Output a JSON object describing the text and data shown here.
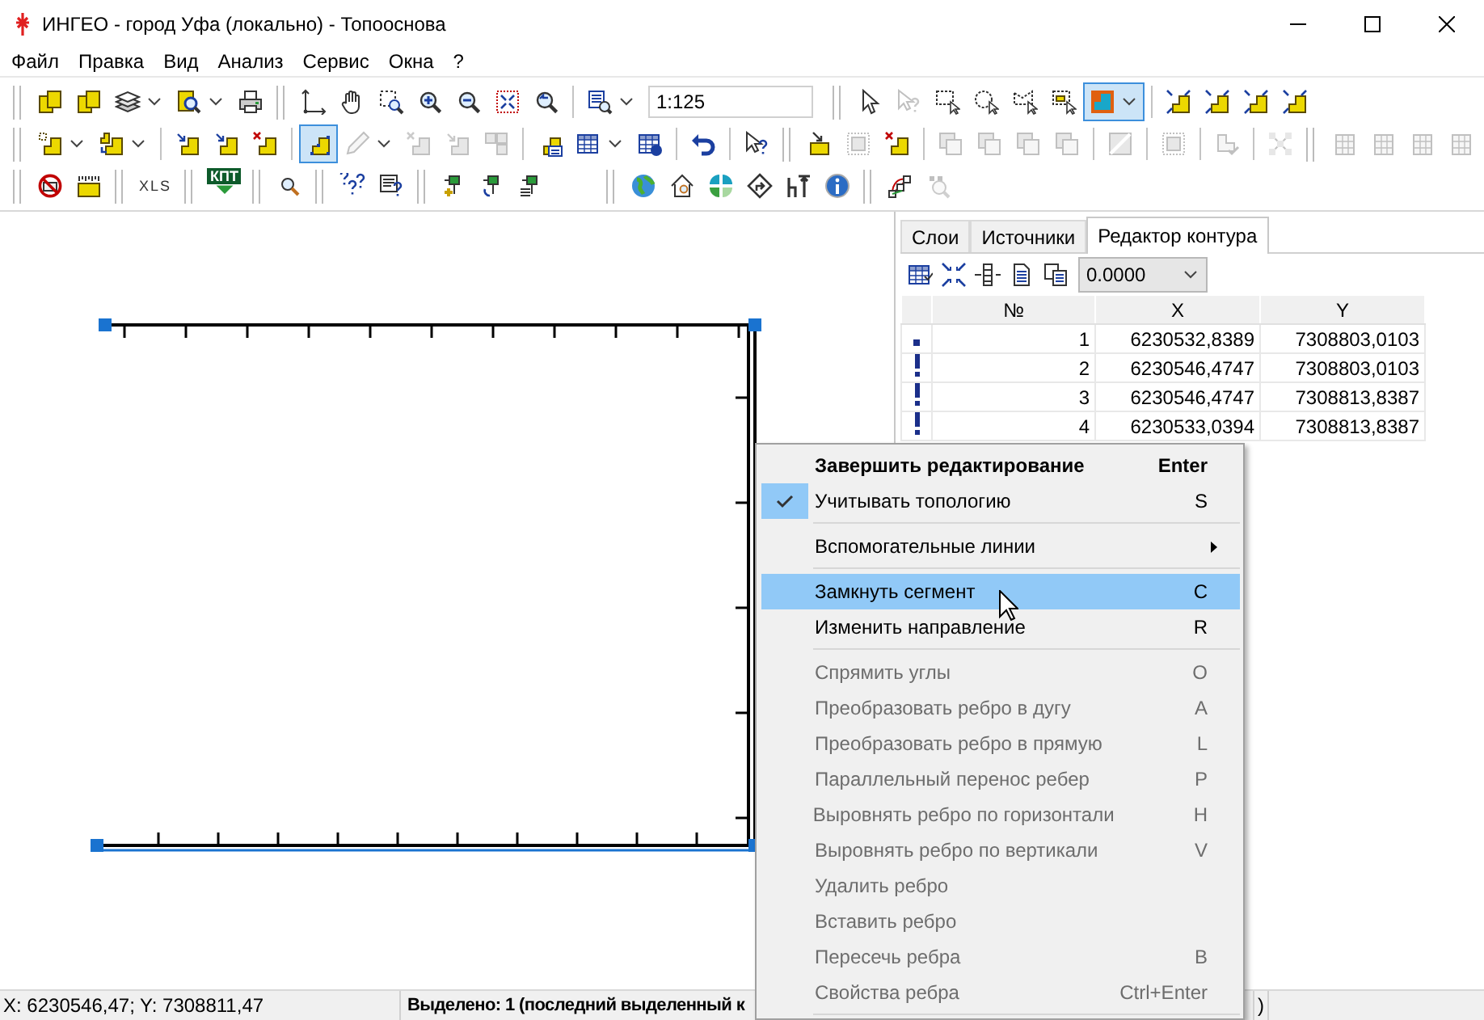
{
  "window": {
    "title": "ИНГЕО - город Уфа (локально) - Топооснова"
  },
  "menu_bar": [
    "Файл",
    "Правка",
    "Вид",
    "Анализ",
    "Сервис",
    "Окна",
    "?"
  ],
  "toolbars": [
    {
      "scale_field": {
        "value": "1:125"
      },
      "groups": [
        [
          {
            "disabled": false,
            "selected": false
          },
          {
            "disabled": false,
            "selected": false
          },
          {
            "disabled": false,
            "selected": false
          },
          {
            "disabled": false,
            "selected": false
          },
          {
            "disabled": false,
            "selected": false
          }
        ],
        [
          {
            "disabled": false,
            "selected": false
          },
          {
            "disabled": false,
            "selected": false
          },
          {
            "disabled": false,
            "selected": false
          },
          {
            "disabled": false,
            "selected": false
          },
          {
            "disabled": false,
            "selected": false
          },
          {
            "disabled": false,
            "selected": false
          },
          {
            "disabled": false,
            "selected": false
          }
        ],
        [
          {
            "disabled": false,
            "selected": false
          }
        ],
        [
          {
            "disabled": false,
            "selected": false
          },
          {
            "disabled": true,
            "selected": false
          },
          {
            "disabled": false,
            "selected": false
          },
          {
            "disabled": false,
            "selected": false
          },
          {
            "disabled": false,
            "selected": false
          },
          {
            "disabled": false,
            "selected": false
          },
          {
            "disabled": false,
            "selected": true
          }
        ],
        [
          {
            "disabled": false,
            "selected": false
          },
          {
            "disabled": false,
            "selected": false
          },
          {
            "disabled": false,
            "selected": false
          },
          {
            "disabled": false,
            "selected": false
          }
        ]
      ]
    },
    {
      "groups": [
        [
          {
            "disabled": false,
            "selected": false
          },
          {
            "disabled": false,
            "selected": false
          }
        ],
        [
          {
            "disabled": false,
            "selected": false
          },
          {
            "disabled": false,
            "selected": false
          },
          {
            "disabled": false,
            "selected": false
          }
        ],
        [
          {
            "disabled": false,
            "selected": true
          },
          {
            "disabled": true,
            "selected": false
          },
          {
            "disabled": true,
            "selected": false
          },
          {
            "disabled": true,
            "selected": false
          },
          {
            "disabled": true,
            "selected": false
          }
        ],
        [
          {
            "disabled": false,
            "selected": false
          },
          {
            "disabled": false,
            "selected": false
          },
          {
            "disabled": false,
            "selected": false
          }
        ],
        [
          {
            "disabled": false,
            "selected": false
          }
        ],
        [
          {
            "disabled": false,
            "selected": false
          }
        ],
        [
          {
            "disabled": false,
            "selected": false
          },
          {
            "disabled": true,
            "selected": false
          },
          {
            "disabled": false,
            "selected": false
          }
        ],
        [
          {
            "disabled": true,
            "selected": false
          },
          {
            "disabled": true,
            "selected": false
          },
          {
            "disabled": true,
            "selected": false
          },
          {
            "disabled": true,
            "selected": false
          }
        ],
        [
          {
            "disabled": true,
            "selected": false
          }
        ],
        [
          {
            "disabled": true,
            "selected": false
          }
        ],
        [
          {
            "disabled": true,
            "selected": false
          }
        ],
        [
          {
            "disabled": true,
            "selected": false
          }
        ],
        [
          {
            "disabled": true,
            "selected": false
          },
          {
            "disabled": true,
            "selected": false
          },
          {
            "disabled": true,
            "selected": false
          },
          {
            "disabled": true,
            "selected": false
          }
        ]
      ]
    },
    {
      "groups": [
        [
          {
            "disabled": false,
            "selected": false
          },
          {
            "disabled": false,
            "selected": false
          }
        ],
        [
          {
            "label": "XLS",
            "disabled": false,
            "selected": false
          }
        ],
        [
          {
            "label": "КПТ",
            "disabled": false,
            "selected": false
          }
        ],
        [
          {
            "disabled": false,
            "selected": false
          }
        ],
        [
          {
            "disabled": false,
            "selected": false
          },
          {
            "disabled": false,
            "selected": false
          }
        ],
        [
          {
            "disabled": false,
            "selected": false
          },
          {
            "disabled": false,
            "selected": false
          },
          {
            "disabled": false,
            "selected": false
          }
        ],
        [
          {
            "disabled": false,
            "selected": false
          },
          {
            "disabled": false,
            "selected": false
          },
          {
            "disabled": false,
            "selected": false
          },
          {
            "disabled": false,
            "selected": false
          },
          {
            "disabled": false,
            "selected": false
          },
          {
            "disabled": false,
            "selected": false
          }
        ],
        [
          {
            "disabled": false,
            "selected": false
          },
          {
            "disabled": true,
            "selected": false
          }
        ]
      ]
    }
  ],
  "side_panel": {
    "tabs": [
      {
        "label": "Слои",
        "selected": false
      },
      {
        "label": "Источники",
        "selected": false
      },
      {
        "label": "Редактор контура",
        "selected": true
      }
    ],
    "tolerance_dropdown": {
      "value": "0.0000"
    },
    "table": {
      "columns": [
        "№",
        "X",
        "Y"
      ],
      "rows": [
        {
          "kind": "start",
          "cells": [
            "1",
            "6230532,8389",
            "7308803,0103"
          ]
        },
        {
          "kind": "vertex",
          "cells": [
            "2",
            "6230546,4747",
            "7308803,0103"
          ]
        },
        {
          "kind": "vertex",
          "cells": [
            "3",
            "6230546,4747",
            "7308813,8387"
          ]
        },
        {
          "kind": "vertex",
          "cells": [
            "4",
            "6230533,0394",
            "7308813,8387"
          ]
        }
      ]
    }
  },
  "context_menu": {
    "items": [
      {
        "kind": "item",
        "label": "Завершить редактирование",
        "shortcut": "Enter",
        "default": true,
        "checked": false,
        "selected": false,
        "disabled": false,
        "submenu": false
      },
      {
        "kind": "item",
        "label": "Учитывать топологию",
        "shortcut": "S",
        "default": false,
        "checked": true,
        "selected": false,
        "disabled": false,
        "submenu": false
      },
      {
        "kind": "separator"
      },
      {
        "kind": "item",
        "label": "Вспомогательные линии",
        "default": false,
        "checked": false,
        "selected": false,
        "disabled": false,
        "submenu": true
      },
      {
        "kind": "separator"
      },
      {
        "kind": "item",
        "label": "Замкнуть сегмент",
        "shortcut": "C",
        "default": false,
        "checked": false,
        "selected": true,
        "disabled": false,
        "submenu": false
      },
      {
        "kind": "item",
        "label": "Изменить направление",
        "shortcut": "R",
        "default": false,
        "checked": false,
        "selected": false,
        "disabled": false,
        "submenu": false
      },
      {
        "kind": "separator"
      },
      {
        "kind": "item",
        "label": "Спрямить углы",
        "shortcut": "O",
        "default": false,
        "checked": false,
        "selected": false,
        "disabled": true,
        "submenu": false
      },
      {
        "kind": "item",
        "label": "Преобразовать ребро в дугу",
        "shortcut": "A",
        "default": false,
        "checked": false,
        "selected": false,
        "disabled": true,
        "submenu": false
      },
      {
        "kind": "item",
        "label": "Преобразовать ребро в прямую",
        "shortcut": "L",
        "default": false,
        "checked": false,
        "selected": false,
        "disabled": true,
        "submenu": false
      },
      {
        "kind": "item",
        "label": "Параллельный перенос ребер",
        "shortcut": "P",
        "default": false,
        "checked": false,
        "selected": false,
        "disabled": true,
        "submenu": false
      },
      {
        "kind": "item",
        "label": "Выровнять ребро по горизонтали",
        "shortcut": "H",
        "default": false,
        "checked": false,
        "selected": false,
        "disabled": true,
        "submenu": false
      },
      {
        "kind": "item",
        "label": "Выровнять ребро по вертикали",
        "shortcut": "V",
        "default": false,
        "checked": false,
        "selected": false,
        "disabled": true,
        "submenu": false
      },
      {
        "kind": "item",
        "label": "Удалить ребро",
        "default": false,
        "checked": false,
        "selected": false,
        "disabled": true,
        "submenu": false
      },
      {
        "kind": "item",
        "label": "Вставить ребро",
        "default": false,
        "checked": false,
        "selected": false,
        "disabled": true,
        "submenu": false
      },
      {
        "kind": "item",
        "label": "Пересечь ребра",
        "shortcut": "B",
        "default": false,
        "checked": false,
        "selected": false,
        "disabled": true,
        "submenu": false
      },
      {
        "kind": "item",
        "label": "Свойства ребра",
        "shortcut": "Ctrl+Enter",
        "default": false,
        "checked": false,
        "selected": false,
        "disabled": true,
        "submenu": false
      },
      {
        "kind": "separator"
      }
    ]
  },
  "status_bar": [
    "X: 6230546,47; Y: 7308811,47",
    "Выделено: 1 (последний выделенный к",
    ")"
  ]
}
